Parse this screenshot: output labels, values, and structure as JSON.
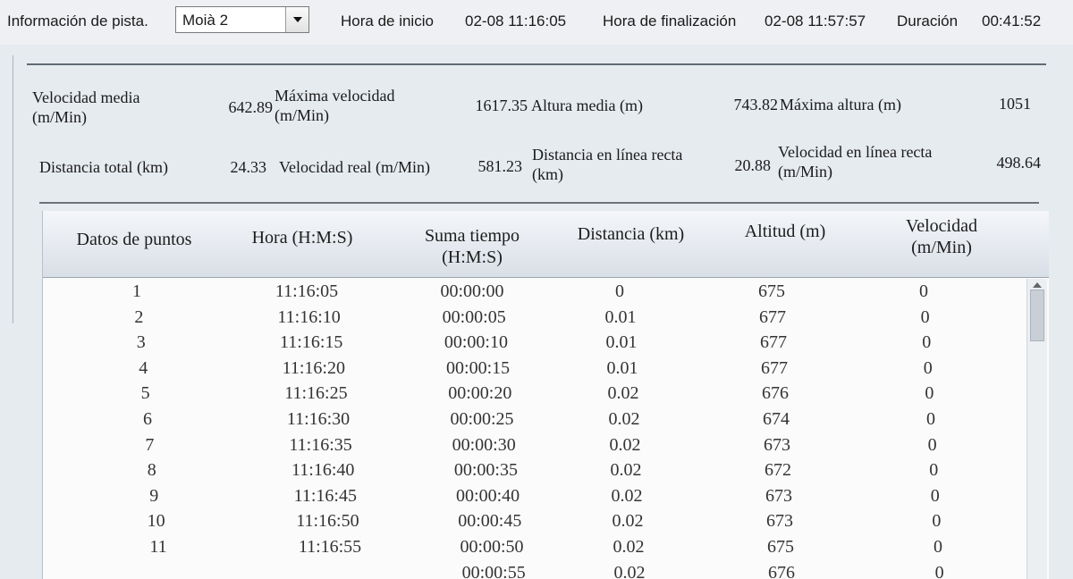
{
  "header": {
    "track_info_label": "Información de pista.",
    "track_selected": "Moià 2",
    "start_label": "Hora de inicio",
    "start_value": "02-08 11:16:05",
    "end_label": "Hora de finalización",
    "end_value": "02-08 11:57:57",
    "duration_label": "Duración",
    "duration_value": "00:41:52"
  },
  "stats": {
    "avg_speed": {
      "line1": "Velocidad media",
      "line2": "(m/Min)",
      "value": "642.89"
    },
    "max_speed": {
      "line1": "Máxima velocidad",
      "line2": "(m/Min)",
      "value": "1617.35"
    },
    "avg_alt": {
      "label": "Altura media (m)",
      "value": "743.82"
    },
    "max_alt": {
      "label": "Máxima altura (m)",
      "value": "1051"
    },
    "total_dist": {
      "label": "Distancia total (km)",
      "value": "24.33"
    },
    "real_speed": {
      "label": "Velocidad real (m/Min)",
      "value": "581.23"
    },
    "straight_dist": {
      "line1": "Distancia en línea recta",
      "line2": "(km)",
      "value": "20.88"
    },
    "straight_speed": {
      "line1": "Velocidad en línea recta",
      "line2": "(m/Min)",
      "value": "498.64"
    }
  },
  "table": {
    "columns": [
      {
        "line1": "Datos de puntos",
        "line2": ""
      },
      {
        "line1": "Hora (H:M:S)",
        "line2": ""
      },
      {
        "line1": "Suma tiempo",
        "line2": "(H:M:S)"
      },
      {
        "line1": "Distancia (km)",
        "line2": ""
      },
      {
        "line1": "Altitud (m)",
        "line2": ""
      },
      {
        "line1": "Velocidad",
        "line2": "(m/Min)"
      }
    ],
    "rows": [
      [
        "1",
        "11:16:05",
        "00:00:00",
        "0",
        "675",
        "0"
      ],
      [
        "2",
        "11:16:10",
        "00:00:05",
        "0.01",
        "677",
        "0"
      ],
      [
        "3",
        "11:16:15",
        "00:00:10",
        "0.01",
        "677",
        "0"
      ],
      [
        "4",
        "11:16:20",
        "00:00:15",
        "0.01",
        "677",
        "0"
      ],
      [
        "5",
        "11:16:25",
        "00:00:20",
        "0.02",
        "676",
        "0"
      ],
      [
        "6",
        "11:16:30",
        "00:00:25",
        "0.02",
        "674",
        "0"
      ],
      [
        "7",
        "11:16:35",
        "00:00:30",
        "0.02",
        "673",
        "0"
      ],
      [
        "8",
        "11:16:40",
        "00:00:35",
        "0.02",
        "672",
        "0"
      ],
      [
        "9",
        "11:16:45",
        "00:00:40",
        "0.02",
        "673",
        "0"
      ],
      [
        "10",
        "11:16:50",
        "00:00:45",
        "0.02",
        "673",
        "0"
      ],
      [
        "11",
        "11:16:55",
        "00:00:50",
        "0.02",
        "675",
        "0"
      ],
      [
        "",
        "",
        "00:00:55",
        "0.02",
        "676",
        "0"
      ]
    ]
  }
}
